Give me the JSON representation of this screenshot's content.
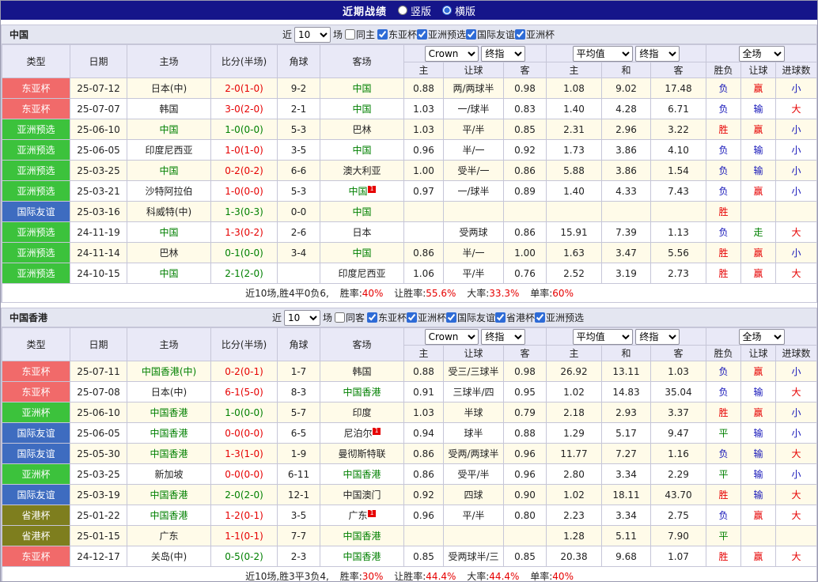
{
  "titlebar": {
    "title": "近期战绩",
    "layout_options": [
      {
        "label": "竖版",
        "selected": false
      },
      {
        "label": "横版",
        "selected": true
      }
    ]
  },
  "sections": [
    {
      "name": "中国",
      "filter": {
        "near": "近",
        "games": "10",
        "games_unit": "场",
        "same_venue": {
          "label": "同主",
          "checked": false
        },
        "leagues": [
          {
            "label": "东亚杯",
            "checked": true
          },
          {
            "label": "亚洲预选",
            "checked": true
          },
          {
            "label": "国际友谊",
            "checked": true
          },
          {
            "label": "亚洲杯",
            "checked": true
          }
        ]
      },
      "selectors": {
        "asian_company": "Crown",
        "asian_time": "终指",
        "euro_type": "平均值",
        "euro_time": "终指",
        "scope": "全场"
      },
      "columns": [
        "类型",
        "日期",
        "主场",
        "比分(半场)",
        "角球",
        "客场",
        "主",
        "让球",
        "客",
        "主",
        "和",
        "客",
        "胜负",
        "让球",
        "进球数"
      ],
      "rows": [
        {
          "type": "东亚杯",
          "type_color": "red",
          "date": "25-07-12",
          "home": "日本(中)",
          "home_green": false,
          "home_sup": "",
          "score": "2-0(1-0)",
          "score_color": "red",
          "corner": "9-2",
          "away": "中国",
          "away_green": true,
          "away_sup": "",
          "asian": [
            "0.88",
            "两/两球半",
            "0.98"
          ],
          "euro": [
            "1.08",
            "9.02",
            "17.48"
          ],
          "result": "负",
          "result_color": "blue",
          "let_result": "赢",
          "let_color": "red",
          "goals": "小",
          "goals_color": "blue"
        },
        {
          "type": "东亚杯",
          "type_color": "red",
          "date": "25-07-07",
          "home": "韩国",
          "home_green": false,
          "home_sup": "",
          "score": "3-0(2-0)",
          "score_color": "red",
          "corner": "2-1",
          "away": "中国",
          "away_green": true,
          "away_sup": "",
          "asian": [
            "1.03",
            "一/球半",
            "0.83"
          ],
          "euro": [
            "1.40",
            "4.28",
            "6.71"
          ],
          "result": "负",
          "result_color": "blue",
          "let_result": "输",
          "let_color": "blue",
          "goals": "大",
          "goals_color": "red"
        },
        {
          "type": "亚洲预选",
          "type_color": "green",
          "date": "25-06-10",
          "home": "中国",
          "home_green": true,
          "home_sup": "",
          "score": "1-0(0-0)",
          "score_color": "green",
          "corner": "5-3",
          "away": "巴林",
          "away_green": false,
          "away_sup": "",
          "asian": [
            "1.03",
            "平/半",
            "0.85"
          ],
          "euro": [
            "2.31",
            "2.96",
            "3.22"
          ],
          "result": "胜",
          "result_color": "red",
          "let_result": "赢",
          "let_color": "red",
          "goals": "小",
          "goals_color": "blue"
        },
        {
          "type": "亚洲预选",
          "type_color": "green",
          "date": "25-06-05",
          "home": "印度尼西亚",
          "home_green": false,
          "home_sup": "",
          "score": "1-0(1-0)",
          "score_color": "red",
          "corner": "3-5",
          "away": "中国",
          "away_green": true,
          "away_sup": "",
          "asian": [
            "0.96",
            "半/一",
            "0.92"
          ],
          "euro": [
            "1.73",
            "3.86",
            "4.10"
          ],
          "result": "负",
          "result_color": "blue",
          "let_result": "输",
          "let_color": "blue",
          "goals": "小",
          "goals_color": "blue"
        },
        {
          "type": "亚洲预选",
          "type_color": "green",
          "date": "25-03-25",
          "home": "中国",
          "home_green": true,
          "home_sup": "",
          "score": "0-2(0-2)",
          "score_color": "red",
          "corner": "6-6",
          "away": "澳大利亚",
          "away_green": false,
          "away_sup": "",
          "asian": [
            "1.00",
            "受半/一",
            "0.86"
          ],
          "euro": [
            "5.88",
            "3.86",
            "1.54"
          ],
          "result": "负",
          "result_color": "blue",
          "let_result": "输",
          "let_color": "blue",
          "goals": "小",
          "goals_color": "blue"
        },
        {
          "type": "亚洲预选",
          "type_color": "green",
          "date": "25-03-21",
          "home": "沙特阿拉伯",
          "home_green": false,
          "home_sup": "",
          "score": "1-0(0-0)",
          "score_color": "red",
          "corner": "5-3",
          "away": "中国",
          "away_green": true,
          "away_sup": "1",
          "asian": [
            "0.97",
            "一/球半",
            "0.89"
          ],
          "euro": [
            "1.40",
            "4.33",
            "7.43"
          ],
          "result": "负",
          "result_color": "blue",
          "let_result": "赢",
          "let_color": "red",
          "goals": "小",
          "goals_color": "blue"
        },
        {
          "type": "国际友谊",
          "type_color": "blue",
          "date": "25-03-16",
          "home": "科威特(中)",
          "home_green": false,
          "home_sup": "",
          "score": "1-3(0-3)",
          "score_color": "green",
          "corner": "0-0",
          "away": "中国",
          "away_green": true,
          "away_sup": "",
          "asian": [
            "",
            "",
            ""
          ],
          "euro": [
            "",
            "",
            ""
          ],
          "result": "胜",
          "result_color": "red",
          "let_result": "",
          "let_color": "black",
          "goals": "",
          "goals_color": "black"
        },
        {
          "type": "亚洲预选",
          "type_color": "green",
          "date": "24-11-19",
          "home": "中国",
          "home_green": true,
          "home_sup": "",
          "score": "1-3(0-2)",
          "score_color": "red",
          "corner": "2-6",
          "away": "日本",
          "away_green": false,
          "away_sup": "",
          "asian": [
            "",
            "受两球",
            "0.86"
          ],
          "euro": [
            "15.91",
            "7.39",
            "1.13"
          ],
          "result": "负",
          "result_color": "blue",
          "let_result": "走",
          "let_color": "green",
          "goals": "大",
          "goals_color": "red"
        },
        {
          "type": "亚洲预选",
          "type_color": "green",
          "date": "24-11-14",
          "home": "巴林",
          "home_green": false,
          "home_sup": "",
          "score": "0-1(0-0)",
          "score_color": "green",
          "corner": "3-4",
          "away": "中国",
          "away_green": true,
          "away_sup": "",
          "asian": [
            "0.86",
            "半/一",
            "1.00"
          ],
          "euro": [
            "1.63",
            "3.47",
            "5.56"
          ],
          "result": "胜",
          "result_color": "red",
          "let_result": "赢",
          "let_color": "red",
          "goals": "小",
          "goals_color": "blue"
        },
        {
          "type": "亚洲预选",
          "type_color": "green",
          "date": "24-10-15",
          "home": "中国",
          "home_green": true,
          "home_sup": "",
          "score": "2-1(2-0)",
          "score_color": "green",
          "corner": "",
          "away": "印度尼西亚",
          "away_green": false,
          "away_sup": "",
          "asian": [
            "1.06",
            "平/半",
            "0.76"
          ],
          "euro": [
            "2.52",
            "3.19",
            "2.73"
          ],
          "result": "胜",
          "result_color": "red",
          "let_result": "赢",
          "let_color": "red",
          "goals": "大",
          "goals_color": "red"
        }
      ],
      "summary": {
        "prefix": "近10场,胜4平0负6,",
        "stats": [
          {
            "label": "胜率:",
            "value": "40%"
          },
          {
            "label": "让胜率:",
            "value": "55.6%"
          },
          {
            "label": "大率:",
            "value": "33.3%"
          },
          {
            "label": "单率:",
            "value": "60%"
          }
        ]
      }
    },
    {
      "name": "中国香港",
      "filter": {
        "near": "近",
        "games": "10",
        "games_unit": "场",
        "same_venue": {
          "label": "同客",
          "checked": false
        },
        "leagues": [
          {
            "label": "东亚杯",
            "checked": true
          },
          {
            "label": "亚洲杯",
            "checked": true
          },
          {
            "label": "国际友谊",
            "checked": true
          },
          {
            "label": "省港杯",
            "checked": true
          },
          {
            "label": "亚洲预选",
            "checked": true
          }
        ]
      },
      "selectors": {
        "asian_company": "Crown",
        "asian_time": "终指",
        "euro_type": "平均值",
        "euro_time": "终指",
        "scope": "全场"
      },
      "columns": [
        "类型",
        "日期",
        "主场",
        "比分(半场)",
        "角球",
        "客场",
        "主",
        "让球",
        "客",
        "主",
        "和",
        "客",
        "胜负",
        "让球",
        "进球数"
      ],
      "rows": [
        {
          "type": "东亚杯",
          "type_color": "red",
          "date": "25-07-11",
          "home": "中国香港(中)",
          "home_green": true,
          "home_sup": "",
          "score": "0-2(0-1)",
          "score_color": "red",
          "corner": "1-7",
          "away": "韩国",
          "away_green": false,
          "away_sup": "",
          "asian": [
            "0.88",
            "受三/三球半",
            "0.98"
          ],
          "euro": [
            "26.92",
            "13.11",
            "1.03"
          ],
          "result": "负",
          "result_color": "blue",
          "let_result": "赢",
          "let_color": "red",
          "goals": "小",
          "goals_color": "blue"
        },
        {
          "type": "东亚杯",
          "type_color": "red",
          "date": "25-07-08",
          "home": "日本(中)",
          "home_green": false,
          "home_sup": "",
          "score": "6-1(5-0)",
          "score_color": "red",
          "corner": "8-3",
          "away": "中国香港",
          "away_green": true,
          "away_sup": "",
          "asian": [
            "0.91",
            "三球半/四",
            "0.95"
          ],
          "euro": [
            "1.02",
            "14.83",
            "35.04"
          ],
          "result": "负",
          "result_color": "blue",
          "let_result": "输",
          "let_color": "blue",
          "goals": "大",
          "goals_color": "red"
        },
        {
          "type": "亚洲杯",
          "type_color": "green",
          "date": "25-06-10",
          "home": "中国香港",
          "home_green": true,
          "home_sup": "",
          "score": "1-0(0-0)",
          "score_color": "green",
          "corner": "5-7",
          "away": "印度",
          "away_green": false,
          "away_sup": "",
          "asian": [
            "1.03",
            "半球",
            "0.79"
          ],
          "euro": [
            "2.18",
            "2.93",
            "3.37"
          ],
          "result": "胜",
          "result_color": "red",
          "let_result": "赢",
          "let_color": "red",
          "goals": "小",
          "goals_color": "blue"
        },
        {
          "type": "国际友谊",
          "type_color": "blue",
          "date": "25-06-05",
          "home": "中国香港",
          "home_green": true,
          "home_sup": "",
          "score": "0-0(0-0)",
          "score_color": "red",
          "corner": "6-5",
          "away": "尼泊尔",
          "away_green": false,
          "away_sup": "1",
          "asian": [
            "0.94",
            "球半",
            "0.88"
          ],
          "euro": [
            "1.29",
            "5.17",
            "9.47"
          ],
          "result": "平",
          "result_color": "green",
          "let_result": "输",
          "let_color": "blue",
          "goals": "小",
          "goals_color": "blue"
        },
        {
          "type": "国际友谊",
          "type_color": "blue",
          "date": "25-05-30",
          "home": "中国香港",
          "home_green": true,
          "home_sup": "",
          "score": "1-3(1-0)",
          "score_color": "red",
          "corner": "1-9",
          "away": "曼彻斯特联",
          "away_green": false,
          "away_sup": "",
          "asian": [
            "0.86",
            "受两/两球半",
            "0.96"
          ],
          "euro": [
            "11.77",
            "7.27",
            "1.16"
          ],
          "result": "负",
          "result_color": "blue",
          "let_result": "输",
          "let_color": "blue",
          "goals": "大",
          "goals_color": "red"
        },
        {
          "type": "亚洲杯",
          "type_color": "green",
          "date": "25-03-25",
          "home": "新加坡",
          "home_green": false,
          "home_sup": "",
          "score": "0-0(0-0)",
          "score_color": "red",
          "corner": "6-11",
          "away": "中国香港",
          "away_green": true,
          "away_sup": "",
          "asian": [
            "0.86",
            "受平/半",
            "0.96"
          ],
          "euro": [
            "2.80",
            "3.34",
            "2.29"
          ],
          "result": "平",
          "result_color": "green",
          "let_result": "输",
          "let_color": "blue",
          "goals": "小",
          "goals_color": "blue"
        },
        {
          "type": "国际友谊",
          "type_color": "blue",
          "date": "25-03-19",
          "home": "中国香港",
          "home_green": true,
          "home_sup": "",
          "score": "2-0(2-0)",
          "score_color": "green",
          "corner": "12-1",
          "away": "中国澳门",
          "away_green": false,
          "away_sup": "",
          "asian": [
            "0.92",
            "四球",
            "0.90"
          ],
          "euro": [
            "1.02",
            "18.11",
            "43.70"
          ],
          "result": "胜",
          "result_color": "red",
          "let_result": "输",
          "let_color": "blue",
          "goals": "大",
          "goals_color": "red"
        },
        {
          "type": "省港杯",
          "type_color": "olive",
          "date": "25-01-22",
          "home": "中国香港",
          "home_green": true,
          "home_sup": "",
          "score": "1-2(0-1)",
          "score_color": "red",
          "corner": "3-5",
          "away": "广东",
          "away_green": false,
          "away_sup": "1",
          "asian": [
            "0.96",
            "平/半",
            "0.80"
          ],
          "euro": [
            "2.23",
            "3.34",
            "2.75"
          ],
          "result": "负",
          "result_color": "blue",
          "let_result": "赢",
          "let_color": "red",
          "goals": "大",
          "goals_color": "red"
        },
        {
          "type": "省港杯",
          "type_color": "olive",
          "date": "25-01-15",
          "home": "广东",
          "home_green": false,
          "home_sup": "",
          "score": "1-1(0-1)",
          "score_color": "red",
          "corner": "7-7",
          "away": "中国香港",
          "away_green": true,
          "away_sup": "",
          "asian": [
            "",
            "",
            ""
          ],
          "euro": [
            "1.28",
            "5.11",
            "7.90"
          ],
          "result": "平",
          "result_color": "green",
          "let_result": "",
          "let_color": "black",
          "goals": "",
          "goals_color": "black"
        },
        {
          "type": "东亚杯",
          "type_color": "red",
          "date": "24-12-17",
          "home": "关岛(中)",
          "home_green": false,
          "home_sup": "",
          "score": "0-5(0-2)",
          "score_color": "green",
          "corner": "2-3",
          "away": "中国香港",
          "away_green": true,
          "away_sup": "",
          "asian": [
            "0.85",
            "受两球半/三",
            "0.85"
          ],
          "euro": [
            "20.38",
            "9.68",
            "1.07"
          ],
          "result": "胜",
          "result_color": "red",
          "let_result": "赢",
          "let_color": "red",
          "goals": "大",
          "goals_color": "red"
        }
      ],
      "summary": {
        "prefix": "近10场,胜3平3负4,",
        "stats": [
          {
            "label": "胜率:",
            "value": "30%"
          },
          {
            "label": "让胜率:",
            "value": "44.4%"
          },
          {
            "label": "大率:",
            "value": "44.4%"
          },
          {
            "label": "单率:",
            "value": "40%"
          }
        ]
      }
    }
  ]
}
